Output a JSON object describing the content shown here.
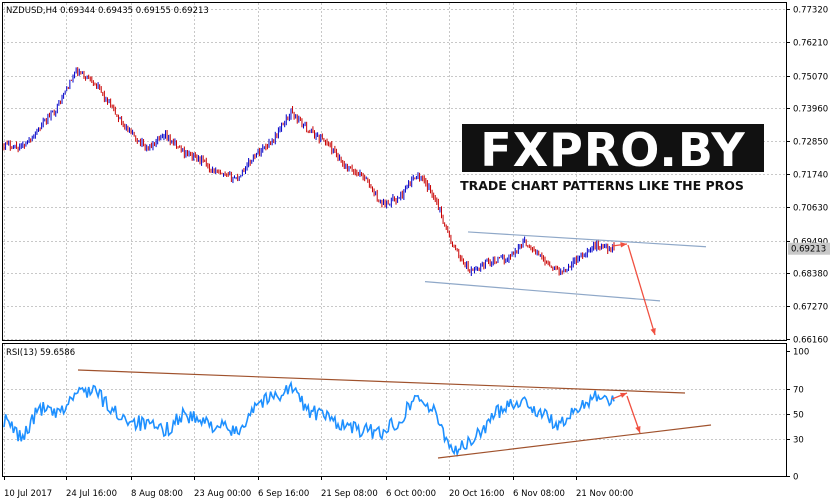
{
  "chart_data": [
    {
      "type": "line",
      "style": "ohlc-bars",
      "title": "NZDUSD,H4  0.69344 0.69435 0.69155 0.69213",
      "symbol": "NZDUSD",
      "timeframe": "H4",
      "last_bar": {
        "open": 0.69344,
        "high": 0.69435,
        "low": 0.69155,
        "close": 0.69213
      },
      "current_price_label": "0.69213",
      "ylim": [
        0.6616,
        0.7732
      ],
      "y_ticks": [
        "0.77320",
        "0.76210",
        "0.75070",
        "0.73960",
        "0.72850",
        "0.71740",
        "0.70630",
        "0.69490",
        "0.68380",
        "0.67270",
        "0.66160"
      ],
      "grid": true,
      "colors": {
        "bull": "#0000c8",
        "bear": "#c80000",
        "price_tag_bg": "#c8c8c8"
      },
      "x": [
        "10 Jul 2017",
        "24 Jul 16:00",
        "8 Aug 08:00",
        "23 Aug 00:00",
        "6 Sep 16:00",
        "21 Sep 08:00",
        "6 Oct 00:00",
        "20 Oct 16:00",
        "6 Nov 08:00",
        "21 Nov 00:00"
      ],
      "series": [
        {
          "values": [
            0.7275,
            0.7265,
            0.733,
            0.7405,
            0.752,
            0.749,
            0.7395,
            0.7315,
            0.726,
            0.73,
            0.725,
            0.722,
            0.717,
            0.716,
            0.724,
            0.729,
            0.7385,
            0.732,
            0.728,
            0.7195,
            0.717,
            0.7075,
            0.709,
            0.7175,
            0.71,
            0.693,
            0.684,
            0.688,
            0.6885,
            0.6945,
            0.689,
            0.684,
            0.689,
            0.6935,
            0.6921
          ]
        }
      ],
      "annotations": {
        "channel_upper": [
          [
            0.6978,
            0.6928
          ]
        ],
        "channel_lower": [
          [
            0.681,
            0.6745
          ]
        ],
        "projection_arrow": "down"
      }
    },
    {
      "type": "line",
      "title": "RSI(13) 59.6586",
      "ylim": [
        0,
        100
      ],
      "y_ticks": [
        "100",
        "70",
        "50",
        "30",
        "0"
      ],
      "colors": {
        "line": "#1e90ff",
        "trendline": "#a0522d"
      },
      "series": [
        {
          "values": [
            45,
            30,
            55,
            48,
            66,
            70,
            52,
            45,
            40,
            36,
            50,
            43,
            40,
            34,
            58,
            63,
            71,
            52,
            47,
            40,
            36,
            35,
            44,
            65,
            50,
            21,
            26,
            43,
            58,
            60,
            49,
            40,
            54,
            66,
            59.66
          ]
        }
      ]
    }
  ],
  "watermark": {
    "brand": "FXPRO.BY",
    "tagline": "TRADE CHART PATTERNS LIKE THE PROS"
  }
}
